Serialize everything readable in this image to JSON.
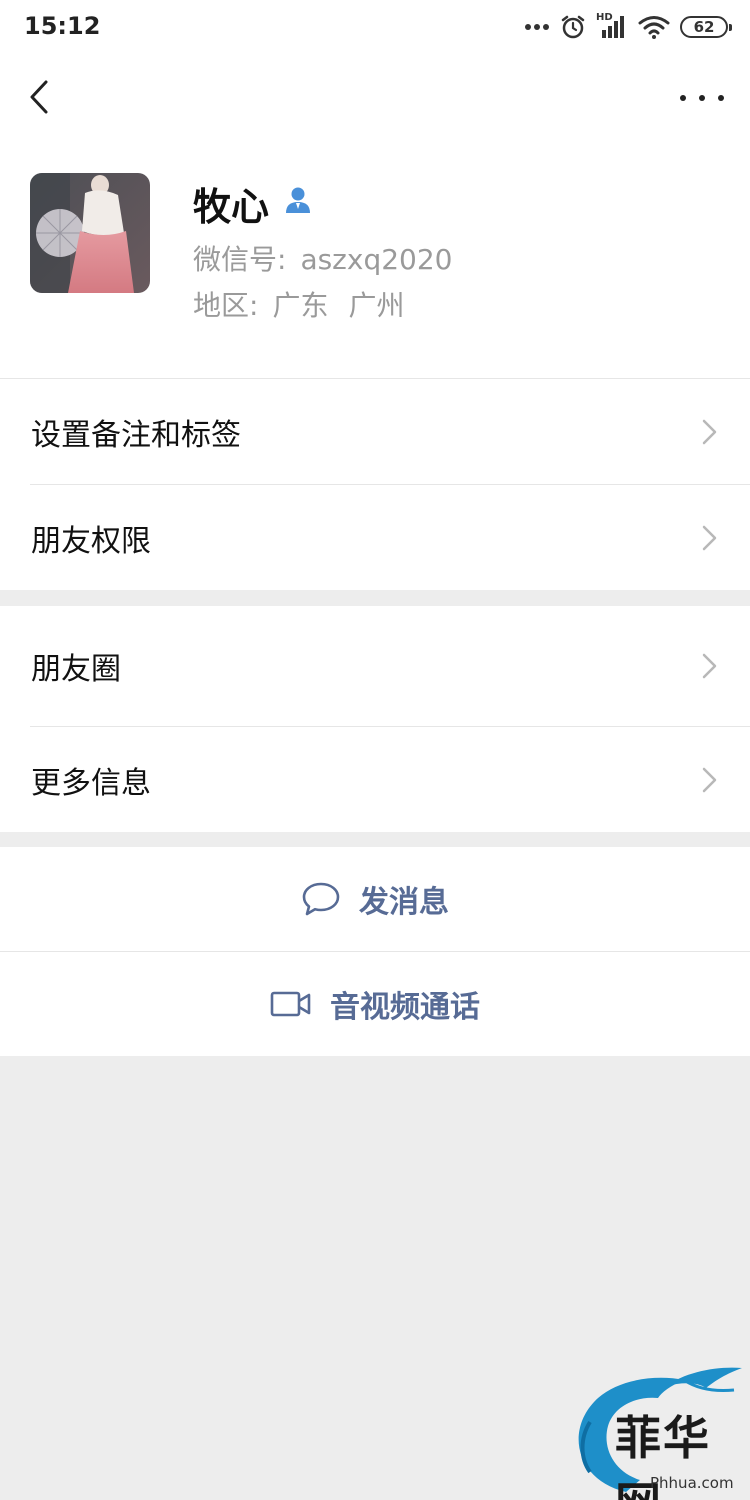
{
  "status_bar": {
    "time": "15:12",
    "network_label": "HD",
    "battery": "62",
    "icons": [
      "more-dots-icon",
      "alarm-icon",
      "signal-icon",
      "wifi-icon",
      "battery-icon"
    ]
  },
  "nav": {
    "back_icon": "chevron-left-icon",
    "more_icon": "more-dots-icon"
  },
  "profile": {
    "name": "牧心",
    "wechat_id_label": "微信号:",
    "wechat_id": "aszxq2020",
    "region_label": "地区:",
    "province": "广东",
    "city": "广州",
    "verify_icon": "person-icon",
    "verify_color": "#4a90d9"
  },
  "menu_group_1": [
    {
      "label": "设置备注和标签"
    },
    {
      "label": "朋友权限"
    }
  ],
  "menu_group_2": [
    {
      "label": "朋友圈"
    },
    {
      "label": "更多信息"
    }
  ],
  "actions": {
    "message_label": "发消息",
    "message_icon": "chat-bubble-icon",
    "call_label": "音视频通话",
    "call_icon": "video-camera-icon",
    "accent_color": "#576b95"
  },
  "watermark": {
    "text": "菲华网",
    "sub": "Phhua.com",
    "brand_color": "#1e8fc9"
  }
}
